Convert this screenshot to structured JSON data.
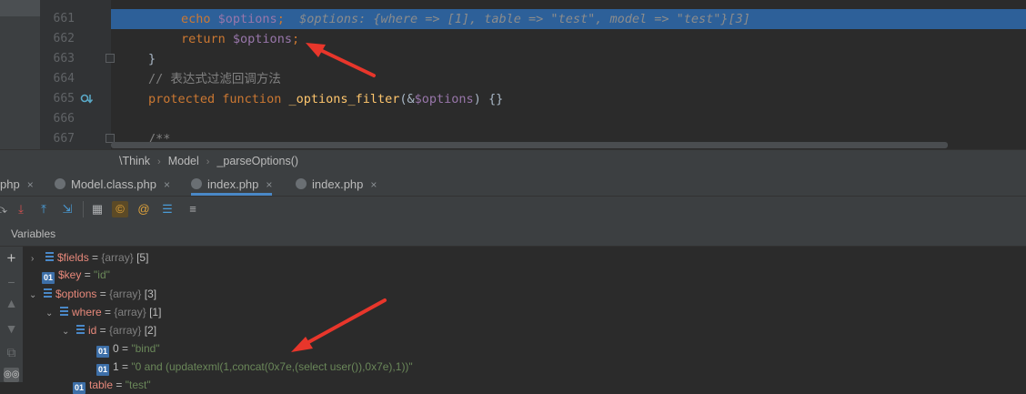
{
  "editor": {
    "lines": [
      {
        "num": "661"
      },
      {
        "num": "662"
      },
      {
        "num": "663"
      },
      {
        "num": "664"
      },
      {
        "num": "665"
      },
      {
        "num": "666"
      },
      {
        "num": "667"
      }
    ],
    "code": {
      "l661_echo": "echo",
      "l661_var": "$options",
      "l661_semi": ";",
      "l661_inline": "$options: {where => [1], table => \"test\", model => \"test\"}[3]",
      "l662_return": "return",
      "l662_var": "$options",
      "l662_semi": ";",
      "l663": "}",
      "l664": "// 表达式过滤回调方法",
      "l665_protected": "protected",
      "l665_function": "function",
      "l665_name": "_options_filter",
      "l665_open": "(&",
      "l665_var": "$options",
      "l665_close": ") {}",
      "l667": "/**"
    }
  },
  "breadcrumb": {
    "items": [
      "\\Think",
      "Model",
      "_parseOptions()"
    ],
    "separator": "›"
  },
  "debug_tabs": [
    {
      "label": "php",
      "close": "×"
    },
    {
      "label": "Model.class.php",
      "close": "×"
    },
    {
      "label": "index.php",
      "close": "×"
    },
    {
      "label": "index.php",
      "close": "×"
    }
  ],
  "variables": {
    "title": "Variables",
    "rows": [
      {
        "name": "$fields",
        "eq": " = ",
        "type": "{array}",
        "extra": " [5]"
      },
      {
        "name": "$key",
        "eq": " = ",
        "value": "\"id\""
      },
      {
        "name": "$options",
        "eq": " = ",
        "type": "{array}",
        "extra": " [3]"
      },
      {
        "name": "where",
        "eq": " = ",
        "type": "{array}",
        "extra": " [1]"
      },
      {
        "name": "id",
        "eq": " = ",
        "type": "{array}",
        "extra": " [2]"
      },
      {
        "name": "0",
        "eq": " = ",
        "value": "\"bind\""
      },
      {
        "name": "1",
        "eq": " = ",
        "value": "\"0 and (updatexml(1,concat(0x7e,(select user()),0x7e),1))\""
      },
      {
        "name": "table",
        "eq": " = ",
        "value": "\"test\""
      }
    ]
  },
  "icons": {
    "int_badge": "01",
    "colors": {
      "highlight": "#2d6099",
      "arrow": "#e8362b",
      "var_name": "#e8897b",
      "string": "#6a8759"
    }
  }
}
